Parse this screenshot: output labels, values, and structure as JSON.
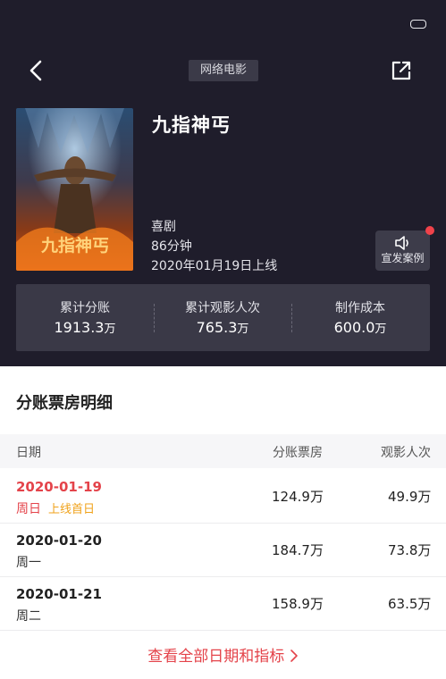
{
  "header": {
    "category_badge": "网络电影",
    "back_icon": "back-arrow-icon",
    "share_icon": "share-icon"
  },
  "movie": {
    "title": "九指神丐",
    "poster_title": "九指神丐",
    "genre": "喜剧",
    "duration": "86分钟",
    "release": "2020年01月19日上线"
  },
  "promo": {
    "label": "宣发案例",
    "icon": "speaker-icon"
  },
  "stats": [
    {
      "label": "累计分账",
      "value": "1913.3",
      "unit": "万"
    },
    {
      "label": "累计观影人次",
      "value": "765.3",
      "unit": "万"
    },
    {
      "label": "制作成本",
      "value": "600.0",
      "unit": "万"
    }
  ],
  "detail": {
    "title": "分账票房明细",
    "columns": [
      "日期",
      "分账票房",
      "观影人次"
    ],
    "rows": [
      {
        "date": "2020-01-19",
        "day": "周日",
        "tag": "上线首日",
        "box": "124.9万",
        "viewers": "49.9万"
      },
      {
        "date": "2020-01-20",
        "day": "周一",
        "tag": "",
        "box": "184.7万",
        "viewers": "73.8万"
      },
      {
        "date": "2020-01-21",
        "day": "周二",
        "tag": "",
        "box": "158.9万",
        "viewers": "63.5万"
      }
    ]
  },
  "more_link": "查看全部日期和指标",
  "colors": {
    "header_bg": "#1f1d2b",
    "accent_red": "#e4434a",
    "tag_orange": "#f0a21a"
  }
}
